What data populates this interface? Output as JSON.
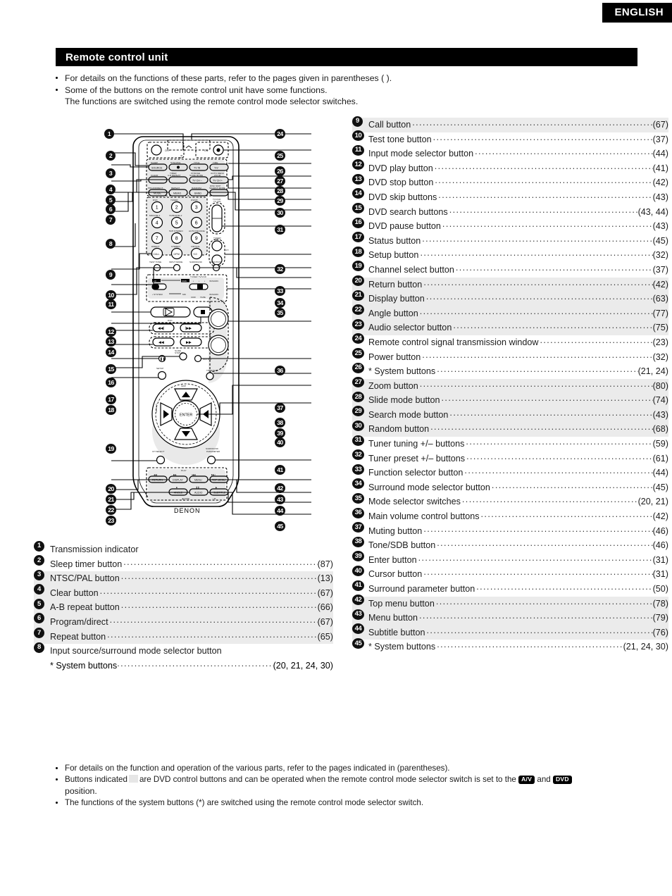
{
  "header": {
    "language_tab": "ENGLISH",
    "section_title": "Remote control unit"
  },
  "intro": {
    "bullet1": "For details on the functions of these parts, refer to the pages given in parentheses ( ).",
    "bullet2": "Some of the buttons on the remote control unit have some functions.",
    "bullet2_cont": "The functions are switched using the remote control mode selector switches."
  },
  "list_left": [
    {
      "num": "1",
      "label": "Transmission indicator",
      "page": "",
      "shaded": false
    },
    {
      "num": "2",
      "label": "Sleep timer button",
      "page": "(87)",
      "shaded": false
    },
    {
      "num": "3",
      "label": "NTSC/PAL button",
      "page": "(13)",
      "shaded": true
    },
    {
      "num": "4",
      "label": "Clear button",
      "page": "(67)",
      "shaded": true
    },
    {
      "num": "5",
      "label": "A-B repeat button",
      "page": "(66)",
      "shaded": true
    },
    {
      "num": "6",
      "label": "Program/direct",
      "page": "(67)",
      "shaded": true
    },
    {
      "num": "7",
      "label": "Repeat button",
      "page": "(65)",
      "shaded": true
    },
    {
      "num": "8",
      "label": "Input source/surround mode selector button",
      "page": "",
      "shaded": false
    }
  ],
  "list_left_sub": {
    "label": "* System buttons",
    "page": "(20, 21, 24, 30)"
  },
  "list_right": [
    {
      "num": "9",
      "label": "Call button",
      "page": "(67)",
      "shaded": true
    },
    {
      "num": "10",
      "label": "Test tone button",
      "page": "(37)",
      "shaded": false
    },
    {
      "num": "11",
      "label": "Input mode selector button",
      "page": "(44)",
      "shaded": false
    },
    {
      "num": "12",
      "label": "DVD play button",
      "page": "(41)",
      "shaded": false
    },
    {
      "num": "13",
      "label": "DVD stop button",
      "page": "(42)",
      "shaded": false
    },
    {
      "num": "14",
      "label": "DVD skip buttons",
      "page": "(43)",
      "shaded": false
    },
    {
      "num": "15",
      "label": "DVD search buttons",
      "page": "(43, 44)",
      "shaded": false
    },
    {
      "num": "16",
      "label": "DVD pause button",
      "page": "(43)",
      "shaded": false
    },
    {
      "num": "17",
      "label": "Status button",
      "page": "(45)",
      "shaded": false
    },
    {
      "num": "18",
      "label": "Setup button",
      "page": "(32)",
      "shaded": false
    },
    {
      "num": "19",
      "label": "Channel select button",
      "page": "(37)",
      "shaded": false
    },
    {
      "num": "20",
      "label": "Return button",
      "page": "(42)",
      "shaded": true
    },
    {
      "num": "21",
      "label": "Display button",
      "page": "(63)",
      "shaded": true
    },
    {
      "num": "22",
      "label": "Angle button",
      "page": "(77)",
      "shaded": true
    },
    {
      "num": "23",
      "label": "Audio selector button",
      "page": "(75)",
      "shaded": true
    },
    {
      "num": "24",
      "label": "Remote control signal transmission window",
      "page": "(23)",
      "shaded": false
    },
    {
      "num": "25",
      "label": "Power button",
      "page": "(32)",
      "shaded": false
    },
    {
      "num": "26",
      "label": "* System buttons",
      "page": "(21, 24)",
      "shaded": false
    },
    {
      "num": "27",
      "label": "Zoom button",
      "page": "(80)",
      "shaded": true
    },
    {
      "num": "28",
      "label": "Slide mode button",
      "page": "(74)",
      "shaded": true
    },
    {
      "num": "29",
      "label": "Search mode button",
      "page": "(43)",
      "shaded": true
    },
    {
      "num": "30",
      "label": "Random button",
      "page": "(68)",
      "shaded": true
    },
    {
      "num": "31",
      "label": "Tuner tuning +/– buttons",
      "page": "(59)",
      "shaded": false
    },
    {
      "num": "32",
      "label": "Tuner preset +/– buttons",
      "page": "(61)",
      "shaded": false
    },
    {
      "num": "33",
      "label": "Function selector button",
      "page": "(44)",
      "shaded": false
    },
    {
      "num": "34",
      "label": "Surround mode selector button",
      "page": "(45)",
      "shaded": false
    },
    {
      "num": "35",
      "label": "Mode selector switches",
      "page": "(20, 21)",
      "shaded": false
    },
    {
      "num": "36",
      "label": "Main volume control buttons",
      "page": "(42)",
      "shaded": false
    },
    {
      "num": "37",
      "label": "Muting button",
      "page": "(46)",
      "shaded": false
    },
    {
      "num": "38",
      "label": "Tone/SDB button",
      "page": "(46)",
      "shaded": false
    },
    {
      "num": "39",
      "label": "Enter button",
      "page": "(31)",
      "shaded": false
    },
    {
      "num": "40",
      "label": "Cursor button",
      "page": "(31)",
      "shaded": false
    },
    {
      "num": "41",
      "label": "Surround parameter button",
      "page": "(50)",
      "shaded": false
    },
    {
      "num": "42",
      "label": "Top menu button",
      "page": "(78)",
      "shaded": true
    },
    {
      "num": "43",
      "label": "Menu button",
      "page": "(79)",
      "shaded": true
    },
    {
      "num": "44",
      "label": "Subtitle button",
      "page": "(76)",
      "shaded": true
    },
    {
      "num": "45",
      "label": "* System buttons",
      "page": "(21, 24, 30)",
      "shaded": false
    }
  ],
  "footer": {
    "bullet1": "For details on the function and operation of the various parts, refer to the pages indicated in (parentheses).",
    "bullet2_a": "Buttons indicated",
    "bullet2_b": "are DVD control buttons and can be operated when the remote control mode selector switch is set to the",
    "bullet2_c": "and",
    "bullet2_d": "position.",
    "badge_av": "A/V",
    "badge_dvd": "DVD",
    "bullet3": "The functions of the system buttons (*) are switched using the remote control mode selector switch."
  },
  "diagram": {
    "brand": "DENON",
    "callouts_left": [
      "1",
      "2",
      "3",
      "4",
      "5",
      "6",
      "7",
      "8",
      "9",
      "10",
      "11",
      "12",
      "13",
      "14",
      "15",
      "16",
      "17",
      "18",
      "19",
      "20",
      "21",
      "22",
      "23"
    ],
    "callouts_right": [
      "24",
      "25",
      "26",
      "27",
      "28",
      "29",
      "30",
      "31",
      "32",
      "33",
      "34",
      "35",
      "36",
      "37",
      "38",
      "39",
      "40",
      "41",
      "42",
      "43",
      "44",
      "45"
    ],
    "power_off_label": "OFF",
    "power_on_label": "ON",
    "keys_top_small": [
      "SLEEP",
      "NTSC/PAL",
      "TITLE",
      "TIME"
    ],
    "keys_row1": [
      "SOURCE",
      "⬤",
      "TV IN",
      "T•V"
    ],
    "keys_row2_small": [
      "CLEAR",
      "TIMER\nA-B REPEAT",
      "CHANGE\nSLIDE MODE",
      "GOTO MENU\nZOOM"
    ],
    "keys_row2": [
      "",
      "",
      "TV CH –",
      "TV CH +"
    ],
    "keys_row3_small": [
      "PRGO/DIRECT",
      "REPEAT",
      "RANDOM",
      "SEARCH MODE"
    ],
    "keys_row3": [
      "MODE",
      "MEMO",
      "BAND",
      ""
    ],
    "numpad_labels": [
      "DVD",
      "TUNER",
      "DVD/R",
      "MD/LINE-1",
      "TAPE/LINE-2",
      "",
      "5CH STEREO",
      "AUTO DECODE",
      "DIRECT",
      "STEREO",
      "VIRTUAL"
    ],
    "numpad": [
      "1",
      "2",
      "3",
      "4",
      "5",
      "6",
      "7",
      "8",
      "9",
      "CALL",
      "0/ FM",
      "+10"
    ],
    "func_row": [
      "TEST TONE",
      "INPUT MODE",
      "SURROUND",
      "FUNCTION"
    ],
    "switch_labels": [
      "A/V",
      "DVD",
      "TUNER  TV/VCR",
      "• SYSTEM",
      "MD",
      "CDR",
      "TAPE",
      "IN/SURR."
    ],
    "tv_vol_label": "TV/VCR\nTV VOL",
    "tuner_label": "TUNER",
    "tuner_ch_label": "CH",
    "dvd_label": "DVD",
    "transport": [
      "▶",
      "■",
      "⏮",
      "⏭",
      "◀◀",
      "▶▶",
      "Ⅱ"
    ],
    "setup_label": "SETUP",
    "ch_select_label": "CH SELECT",
    "enter_label": "ENTER",
    "muting_label": "MUTING",
    "tone_sdb_label": "TONE/SDB",
    "surround_param_label": "SURROUND\nPARAMETER",
    "bottom_keys": [
      "RETURN",
      "DISPLAY",
      "MENU",
      "TOP MENU",
      "ANGLE",
      "AUDIO",
      "SUBTITLE"
    ],
    "play_label": "PLAY"
  }
}
